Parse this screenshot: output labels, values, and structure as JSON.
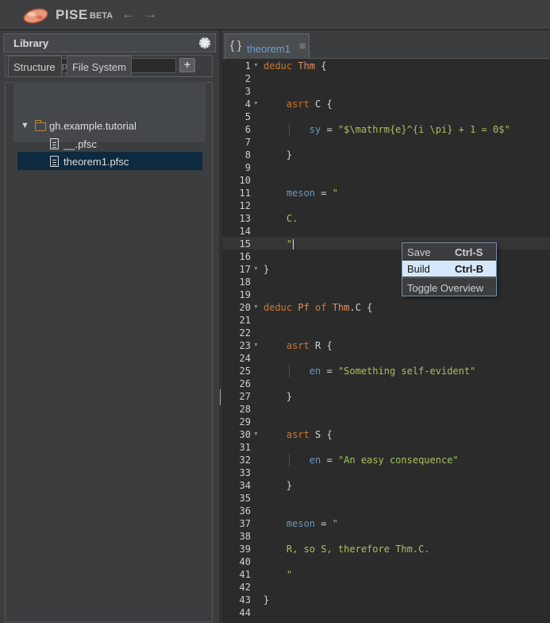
{
  "app": {
    "name": "PISE",
    "badge": "BETA",
    "back_icon": "left-arrow-icon",
    "forward_icon": "right-arrow-icon"
  },
  "library": {
    "title": "Library",
    "repo_input": {
      "placeholder": "host.user.repo@version",
      "value": ""
    },
    "add_button_label": "+",
    "tabs": [
      {
        "label": "Structure",
        "active": false
      },
      {
        "label": "File System",
        "active": true
      }
    ],
    "tree": {
      "root": "gh.example.tutorial",
      "files": [
        {
          "name": "__.pfsc",
          "selected": false
        },
        {
          "name": "theorem1.pfsc",
          "selected": true
        }
      ]
    }
  },
  "editor": {
    "tab": {
      "icon": "{ }",
      "label": "theorem1",
      "close": "⊠"
    },
    "line_count": 44,
    "active_line": 15,
    "fold_lines": [
      1,
      4,
      17,
      20,
      23,
      30
    ],
    "lines": {
      "1": [
        [
          "kw",
          "deduc "
        ],
        [
          "cls",
          "Thm"
        ],
        [
          "",
          " {"
        ]
      ],
      "4": [
        [
          "",
          "    "
        ],
        [
          "kw",
          "asrt"
        ],
        [
          "",
          " C {"
        ]
      ],
      "6": [
        [
          "",
          "        "
        ],
        [
          "kw2",
          "sy"
        ],
        [
          "",
          " = "
        ],
        [
          "str",
          "\"$\\mathrm{e}^{i \\pi} + 1 = 0$\""
        ]
      ],
      "8": [
        [
          "",
          "    }"
        ]
      ],
      "11": [
        [
          "",
          "    "
        ],
        [
          "kw2",
          "meson"
        ],
        [
          "",
          " = "
        ],
        [
          "str",
          "\""
        ]
      ],
      "13": [
        [
          "",
          "    "
        ],
        [
          "str",
          "C."
        ]
      ],
      "15": [
        [
          "",
          "    "
        ],
        [
          "str",
          "\""
        ]
      ],
      "17": [
        [
          "",
          "}"
        ]
      ],
      "20": [
        [
          "kw",
          "deduc "
        ],
        [
          "cls",
          "Pf"
        ],
        [
          "kw",
          " of "
        ],
        [
          "cls",
          "Thm"
        ],
        [
          "",
          ".C {"
        ]
      ],
      "23": [
        [
          "",
          "    "
        ],
        [
          "kw",
          "asrt"
        ],
        [
          "",
          " R {"
        ]
      ],
      "25": [
        [
          "",
          "        "
        ],
        [
          "kw2",
          "en"
        ],
        [
          "",
          " = "
        ],
        [
          "str",
          "\"Something self-evident\""
        ]
      ],
      "27": [
        [
          "",
          "    }"
        ]
      ],
      "30": [
        [
          "",
          "    "
        ],
        [
          "kw",
          "asrt"
        ],
        [
          "",
          " S {"
        ]
      ],
      "32": [
        [
          "",
          "        "
        ],
        [
          "kw2",
          "en"
        ],
        [
          "",
          " = "
        ],
        [
          "str",
          "\"An easy consequence\""
        ]
      ],
      "34": [
        [
          "",
          "    }"
        ]
      ],
      "37": [
        [
          "",
          "    "
        ],
        [
          "kw2",
          "meson"
        ],
        [
          "",
          " = "
        ],
        [
          "str",
          "\""
        ]
      ],
      "39": [
        [
          "",
          "    "
        ],
        [
          "str",
          "R, so S, therefore Thm.C."
        ]
      ],
      "41": [
        [
          "",
          "    "
        ],
        [
          "str",
          "\""
        ]
      ],
      "43": [
        [
          "",
          "}"
        ]
      ]
    }
  },
  "context_menu": {
    "items": [
      {
        "label": "Save",
        "shortcut": "Ctrl-S",
        "highlighted": false
      },
      {
        "label": "Build",
        "shortcut": "Ctrl-B",
        "highlighted": true
      },
      {
        "label": "Toggle Overview",
        "shortcut": "",
        "highlighted": false
      }
    ]
  },
  "colors": {
    "accent": "#6a9fd5",
    "keyword": "#cc7832",
    "string": "#a5c25c",
    "class": "#e0935e",
    "selection": "#0d2a3f"
  }
}
